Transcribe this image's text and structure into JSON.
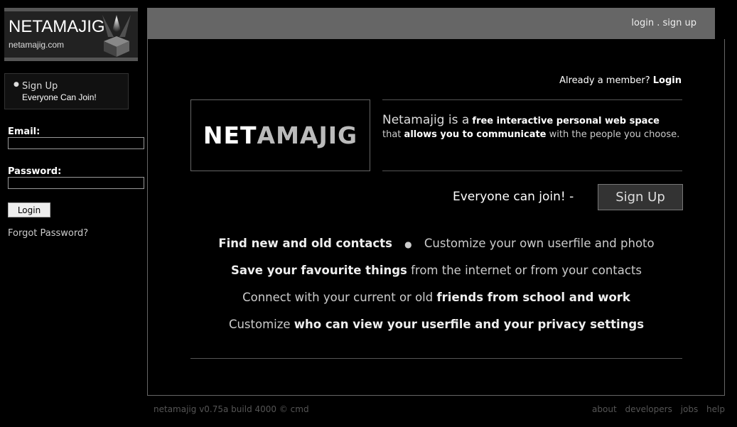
{
  "logo": {
    "title": "NETAMAJIG",
    "subtitle": "netamajig.com"
  },
  "sidebar": {
    "signup_link": "Sign Up",
    "signup_tagline": "Everyone Can Join!",
    "email_label": "Email:",
    "email_value": "",
    "password_label": "Password:",
    "password_value": "",
    "login_button": "Login",
    "forgot_password": "Forgot Password?"
  },
  "topbar": {
    "login": "login",
    "separator": ".",
    "signup": "sign up"
  },
  "main": {
    "member_prompt": "Already a member?",
    "member_login": "Login",
    "big_logo_part1": "NET",
    "big_logo_part2": "AMAJIG",
    "intro_lead": "Netamajig is a",
    "intro_bold1": "free interactive personal web space",
    "intro_mid": "that",
    "intro_bold2": "allows you to communicate",
    "intro_end": "with the people you choose.",
    "join_text": "Everyone can join! -",
    "signup_button": "Sign Up",
    "features": [
      {
        "bold_a": "Find new and old contacts",
        "dot": "●",
        "plain_a": "Customize your own userfile and photo"
      },
      {
        "bold_a": "Save your favourite things",
        "plain_a": "from the internet or from your contacts"
      },
      {
        "plain_a": "Connect with your current or old",
        "bold_a": "friends from school and work"
      },
      {
        "plain_a": "Customize",
        "bold_a": "who can view your userfile and your privacy settings"
      }
    ]
  },
  "footer": {
    "version": "netamajig v0.75a build 4000 © cmd",
    "links": [
      "about",
      "developers",
      "jobs",
      "help"
    ]
  },
  "colors": {
    "background": "#000000",
    "topbar": "#666666",
    "border": "#666666",
    "text": "#dddddd"
  }
}
